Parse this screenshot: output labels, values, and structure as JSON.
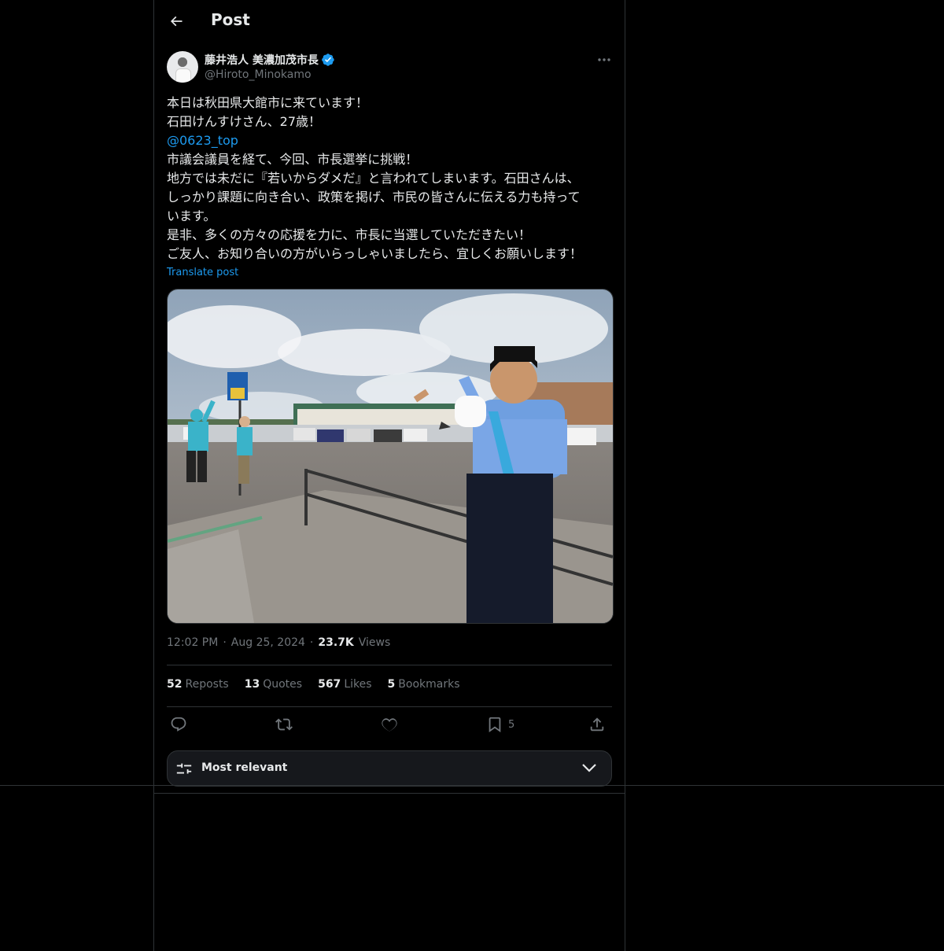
{
  "header": {
    "title": "Post",
    "back_icon": "arrow-left-icon"
  },
  "author": {
    "name": "藤井浩人 美濃加茂市長",
    "handle": "@Hiroto_Minokamo",
    "verified": true,
    "verified_color": "#1d9bf0"
  },
  "post": {
    "lines": [
      "本日は秋田県大館市に来ています！",
      "石田けんすけさん、27歳！",
      "@0623_top",
      "市議会議員を経て、今回、市長選挙に挑戦！",
      "地方では未だに『若いからダメだ』と言われてしまいます。石田さんは、",
      "しっかり課題に向き合い、政策を掲げ、市民の皆さんに伝える力も持って",
      "います。",
      "是非、多くの方々の応援を力に、市長に当選していただきたい！",
      "ご友人、お知り合いの方がいらっしゃいましたら、宜しくお願いします！"
    ],
    "translate_label": "Translate post"
  },
  "meta": {
    "time": "12:02 PM",
    "date": "Aug 25, 2024",
    "views_count": "23.7K",
    "views_label": "Views",
    "dot": "·"
  },
  "stats": {
    "reposts_count": "52",
    "reposts_label": "Reposts",
    "quotes_count": "13",
    "quotes_label": "Quotes",
    "likes_count": "567",
    "likes_label": "Likes",
    "bookmarks_count": "5",
    "bookmarks_label": "Bookmarks"
  },
  "actions": {
    "reply_icon": "reply-icon",
    "repost_icon": "repost-icon",
    "like_icon": "heart-icon",
    "bookmark_icon": "bookmark-icon",
    "bookmark_count": "5",
    "share_icon": "share-icon"
  },
  "sort": {
    "label": "Most relevant",
    "icon": "sliders-icon",
    "chevron": "chevron-down-icon"
  },
  "colors": {
    "background": "#000000",
    "text": "#e7e9ea",
    "muted": "#71767b",
    "accent": "#1d9bf0",
    "border": "#2f3336"
  }
}
